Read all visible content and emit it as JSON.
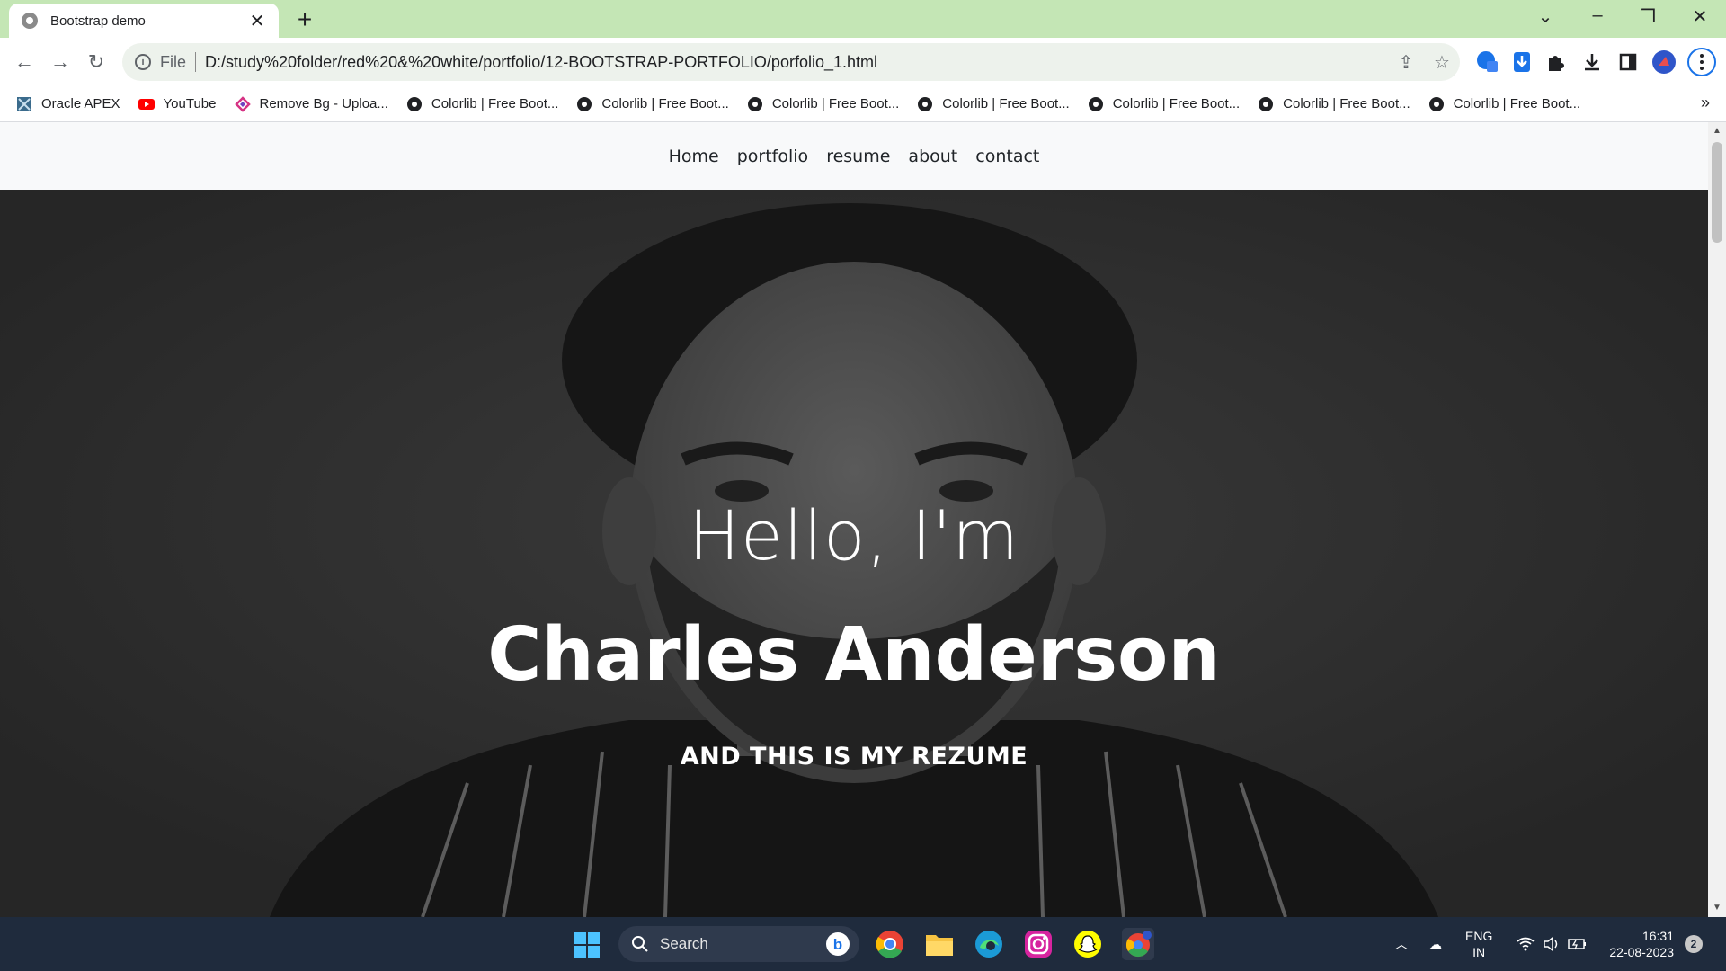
{
  "browser": {
    "tab_title": "Bootstrap demo",
    "file_label": "File",
    "url": "D:/study%20folder/red%20&%20white/portfolio/12-BOOTSTRAP-PORTFOLIO/porfolio_1.html",
    "bookmarks": [
      {
        "label": "Oracle APEX",
        "icon": "oracle-apex-icon"
      },
      {
        "label": "YouTube",
        "icon": "youtube-icon"
      },
      {
        "label": "Remove Bg - Uploa...",
        "icon": "remove-bg-icon"
      },
      {
        "label": "Colorlib | Free Boot...",
        "icon": "colorlib-icon"
      },
      {
        "label": "Colorlib | Free Boot...",
        "icon": "colorlib-icon"
      },
      {
        "label": "Colorlib | Free Boot...",
        "icon": "colorlib-icon"
      },
      {
        "label": "Colorlib | Free Boot...",
        "icon": "colorlib-icon"
      },
      {
        "label": "Colorlib | Free Boot...",
        "icon": "colorlib-icon"
      },
      {
        "label": "Colorlib | Free Boot...",
        "icon": "colorlib-icon"
      },
      {
        "label": "Colorlib | Free Boot...",
        "icon": "colorlib-icon"
      }
    ],
    "colors": {
      "tabstrip": "#c4e6b5",
      "omnibox": "#edf2ec"
    }
  },
  "site": {
    "nav": [
      "Home",
      "portfolio",
      "resume",
      "about",
      "contact"
    ],
    "hero": {
      "greeting": "Hello, I'm",
      "name": "Charles Anderson",
      "tagline": "AND THIS IS MY REZUME"
    }
  },
  "taskbar": {
    "search_label": "Search",
    "language": "ENG",
    "region": "IN",
    "time": "16:31",
    "date": "22-08-2023",
    "notifications": "2",
    "apps": [
      "chrome-icon",
      "file-explorer-icon",
      "edge-icon",
      "instagram-icon",
      "snapchat-icon",
      "chrome-profile-icon"
    ]
  }
}
